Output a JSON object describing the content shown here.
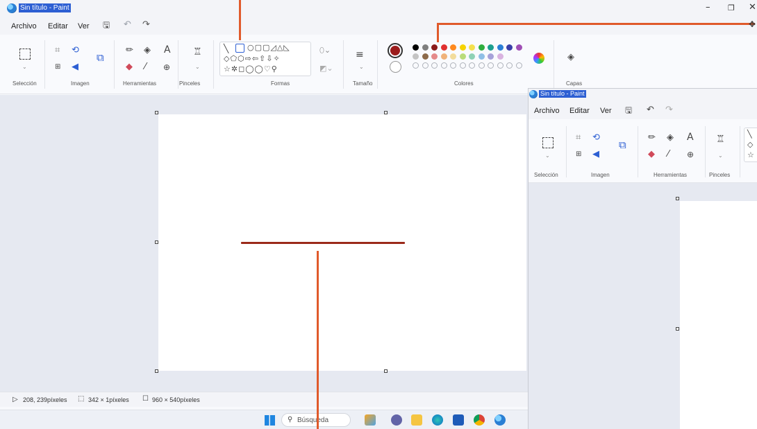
{
  "main_window": {
    "title": "Sin título - Paint",
    "menu": [
      "Archivo",
      "Editar",
      "Ver"
    ],
    "groups": {
      "seleccion": "Selección",
      "imagen": "Imagen",
      "herramientas": "Herramientas",
      "pinceles": "Pinceles",
      "formas": "Formas",
      "tamano": "Tamaño",
      "colores": "Colores",
      "capas": "Capas"
    },
    "text_tool_glyph": "A",
    "status": {
      "cursor": "208, 239píxeles",
      "selection": "342 × 1píxeles",
      "canvas_size": "960 × 540píxeles"
    },
    "colors": {
      "primary": "#9b1b1b",
      "secondary": "#ffffff",
      "palette_row1": [
        "#000000",
        "#7f7f7f",
        "#8b1a1a",
        "#e03030",
        "#ff8a1f",
        "#f6d300",
        "#f4e04d",
        "#2fae3f",
        "#1d9f8f",
        "#2b7fd6",
        "#3a3fa8",
        "#a04fb5"
      ],
      "palette_row2": [
        "#c4c4c4",
        "#8c6a4a",
        "#e58a8a",
        "#f0b27a",
        "#f2dc9b",
        "#b9dc7a",
        "#8fd1b5",
        "#8fbfe6",
        "#a6a2d9",
        "#d9b3e0"
      ]
    },
    "drawn_line_color": "#9b2a1a"
  },
  "taskbar": {
    "search_placeholder": "Búsqueda"
  },
  "second_window": {
    "title": "Sin título - Paint",
    "menu": [
      "Archivo",
      "Editar",
      "Ver"
    ],
    "groups": {
      "seleccion": "Selección",
      "imagen": "Imagen",
      "herramientas": "Herramientas",
      "pinceles": "Pinceles"
    },
    "text_tool_glyph": "A"
  },
  "annotation_color": "#e05a2b"
}
